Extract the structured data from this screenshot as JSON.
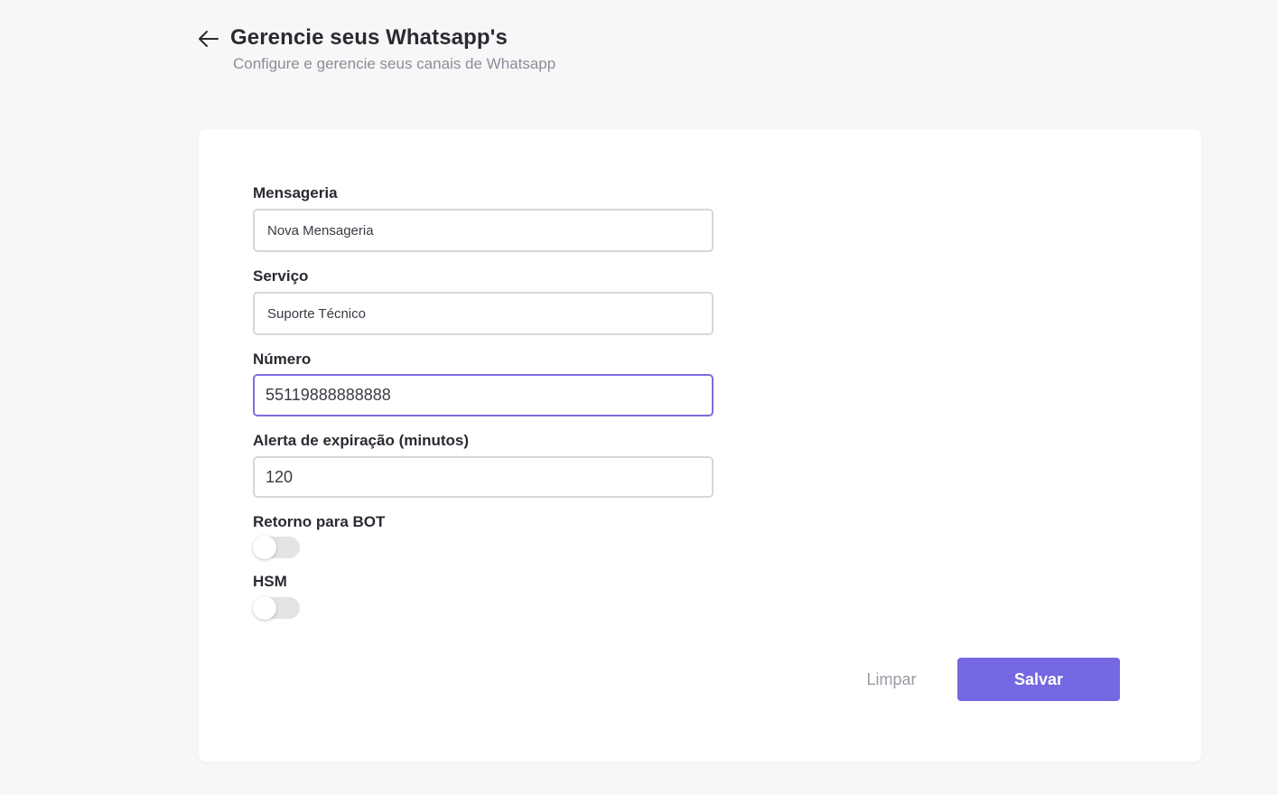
{
  "header": {
    "title": "Gerencie seus Whatsapp's",
    "subtitle": "Configure e gerencie seus canais de Whatsapp",
    "back_icon": "arrow-left-icon"
  },
  "form": {
    "messaging": {
      "label": "Mensageria",
      "value": "Nova Mensageria"
    },
    "service": {
      "label": "Serviço",
      "value": "Suporte Técnico"
    },
    "number": {
      "label": "Número",
      "value": "55119888888888"
    },
    "expiration_alert": {
      "label": "Alerta de expiração (minutos)",
      "value": "120"
    },
    "return_to_bot": {
      "label": "Retorno para BOT",
      "enabled": false
    },
    "hsm": {
      "label": "HSM",
      "enabled": false
    }
  },
  "actions": {
    "clear_label": "Limpar",
    "save_label": "Salvar"
  },
  "colors": {
    "accent": "#7469e2",
    "focus_border": "#7a6ee0",
    "background": "#f7f7f7",
    "card": "#ffffff",
    "muted_text": "#8c8c9a"
  }
}
